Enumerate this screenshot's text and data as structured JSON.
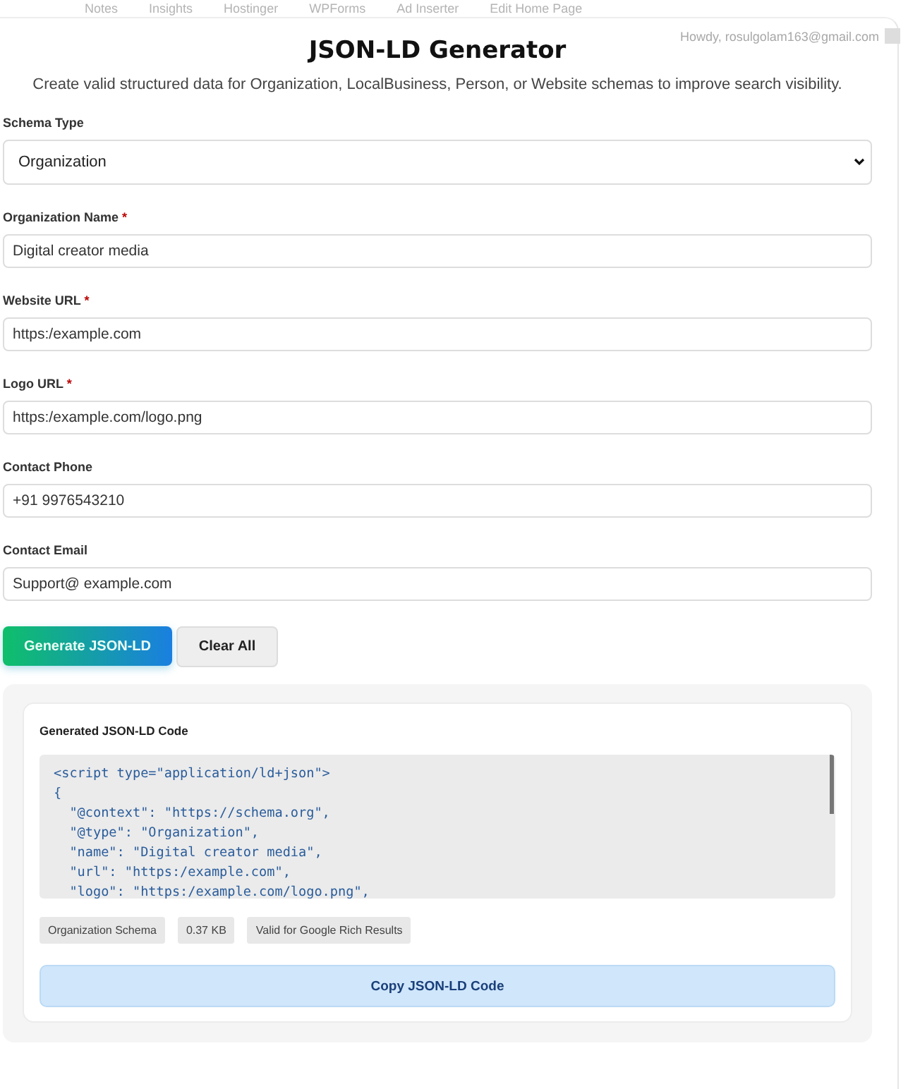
{
  "admin_bar": {
    "items": [
      "Notes",
      "Insights",
      "Hostinger",
      "WPForms",
      "Ad Inserter",
      "Edit Home Page"
    ],
    "greeting": "Howdy, rosulgolam163@gmail.com"
  },
  "title": "JSON-LD Generator",
  "required_mark": "*",
  "subtitle": "Create valid structured data for Organization, LocalBusiness, Person, or Website schemas to improve search visibility.",
  "schema_type": {
    "label": "Schema Type",
    "value": "Organization"
  },
  "fields": [
    {
      "label": "Organization Name",
      "required": true,
      "value": "Digital creator media"
    },
    {
      "label": "Website URL",
      "required": true,
      "value": "https:/example.com"
    },
    {
      "label": "Logo URL",
      "required": true,
      "value": "https:/example.com/logo.png"
    },
    {
      "label": "Contact Phone",
      "required": false,
      "value": "+91 9976543210"
    },
    {
      "label": "Contact Email",
      "required": false,
      "value": "Support@ example.com"
    }
  ],
  "buttons": {
    "generate": "Generate JSON-LD",
    "clear": "Clear All"
  },
  "output": {
    "title": "Generated JSON-LD Code",
    "code_lines": [
      "<script type=\"application/ld+json\">",
      "{",
      "  \"@context\": \"https://schema.org\",",
      "  \"@type\": \"Organization\",",
      "  \"name\": \"Digital creator media\",",
      "  \"url\": \"https:/example.com\",",
      "  \"logo\": \"https:/example.com/logo.png\","
    ],
    "badges": [
      "Organization Schema",
      "0.37 KB",
      "Valid for Google Rich Results"
    ],
    "copy_button": "Copy JSON-LD Code"
  }
}
